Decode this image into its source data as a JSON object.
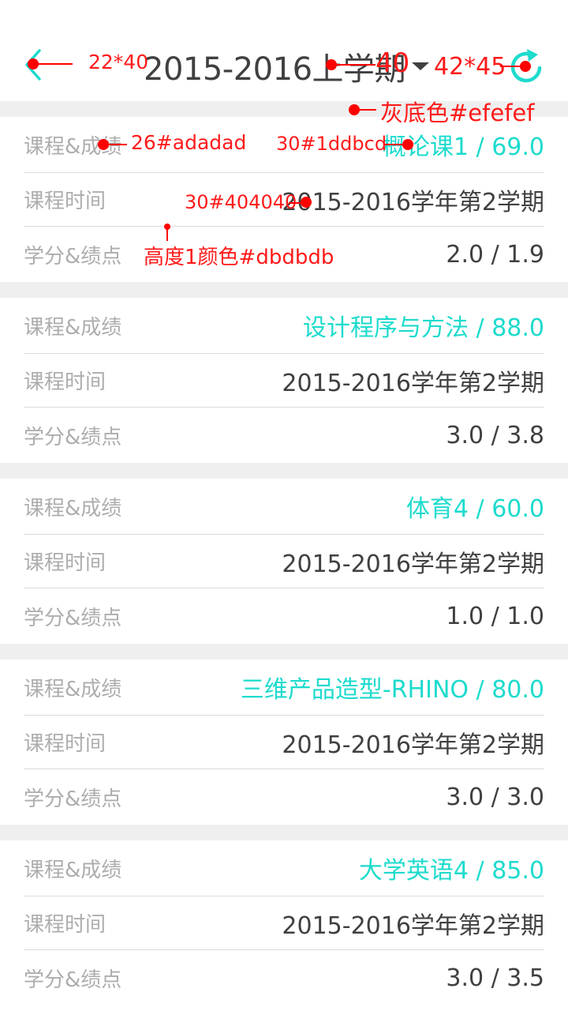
{
  "header": {
    "title": "2015-2016上学期",
    "back_icon": "arrow-left-icon",
    "refresh_icon": "refresh-icon",
    "accent_color": "#1ddbcd"
  },
  "courses": [
    {
      "course_label": "课程&成绩",
      "course_value": "概论课1 / 69.0",
      "time_label": "课程时间",
      "time_value": "2015-2016学年第2学期",
      "credit_label": "学分&绩点",
      "credit_value": "2.0 / 1.9"
    },
    {
      "course_label": "课程&成绩",
      "course_value": "设计程序与方法 / 88.0",
      "time_label": "课程时间",
      "time_value": "2015-2016学年第2学期",
      "credit_label": "学分&绩点",
      "credit_value": "3.0 / 3.8"
    },
    {
      "course_label": "课程&成绩",
      "course_value": "体育4 / 60.0",
      "time_label": "课程时间",
      "time_value": "2015-2016学年第2学期",
      "credit_label": "学分&绩点",
      "credit_value": "1.0 / 1.0"
    },
    {
      "course_label": "课程&成绩",
      "course_value": "三维产品造型-RHINO / 80.0",
      "time_label": "课程时间",
      "time_value": "2015-2016学年第2学期",
      "credit_label": "学分&绩点",
      "credit_value": "3.0 / 3.0"
    },
    {
      "course_label": "课程&成绩",
      "course_value": "大学英语4 / 85.0",
      "time_label": "课程时间",
      "time_value": "2015-2016学年第2学期",
      "credit_label": "学分&绩点",
      "credit_value": "3.0 / 3.5"
    }
  ],
  "annotations": {
    "back_size": "22*40",
    "title_size": "40",
    "refresh_size": "42*45",
    "gray_bg": "灰底色#efefef",
    "label_spec": "26#adadad",
    "accent_spec": "30#1ddbcd",
    "value_spec": "30#404040",
    "divider_spec": "高度1颜色#dbdbdb"
  }
}
